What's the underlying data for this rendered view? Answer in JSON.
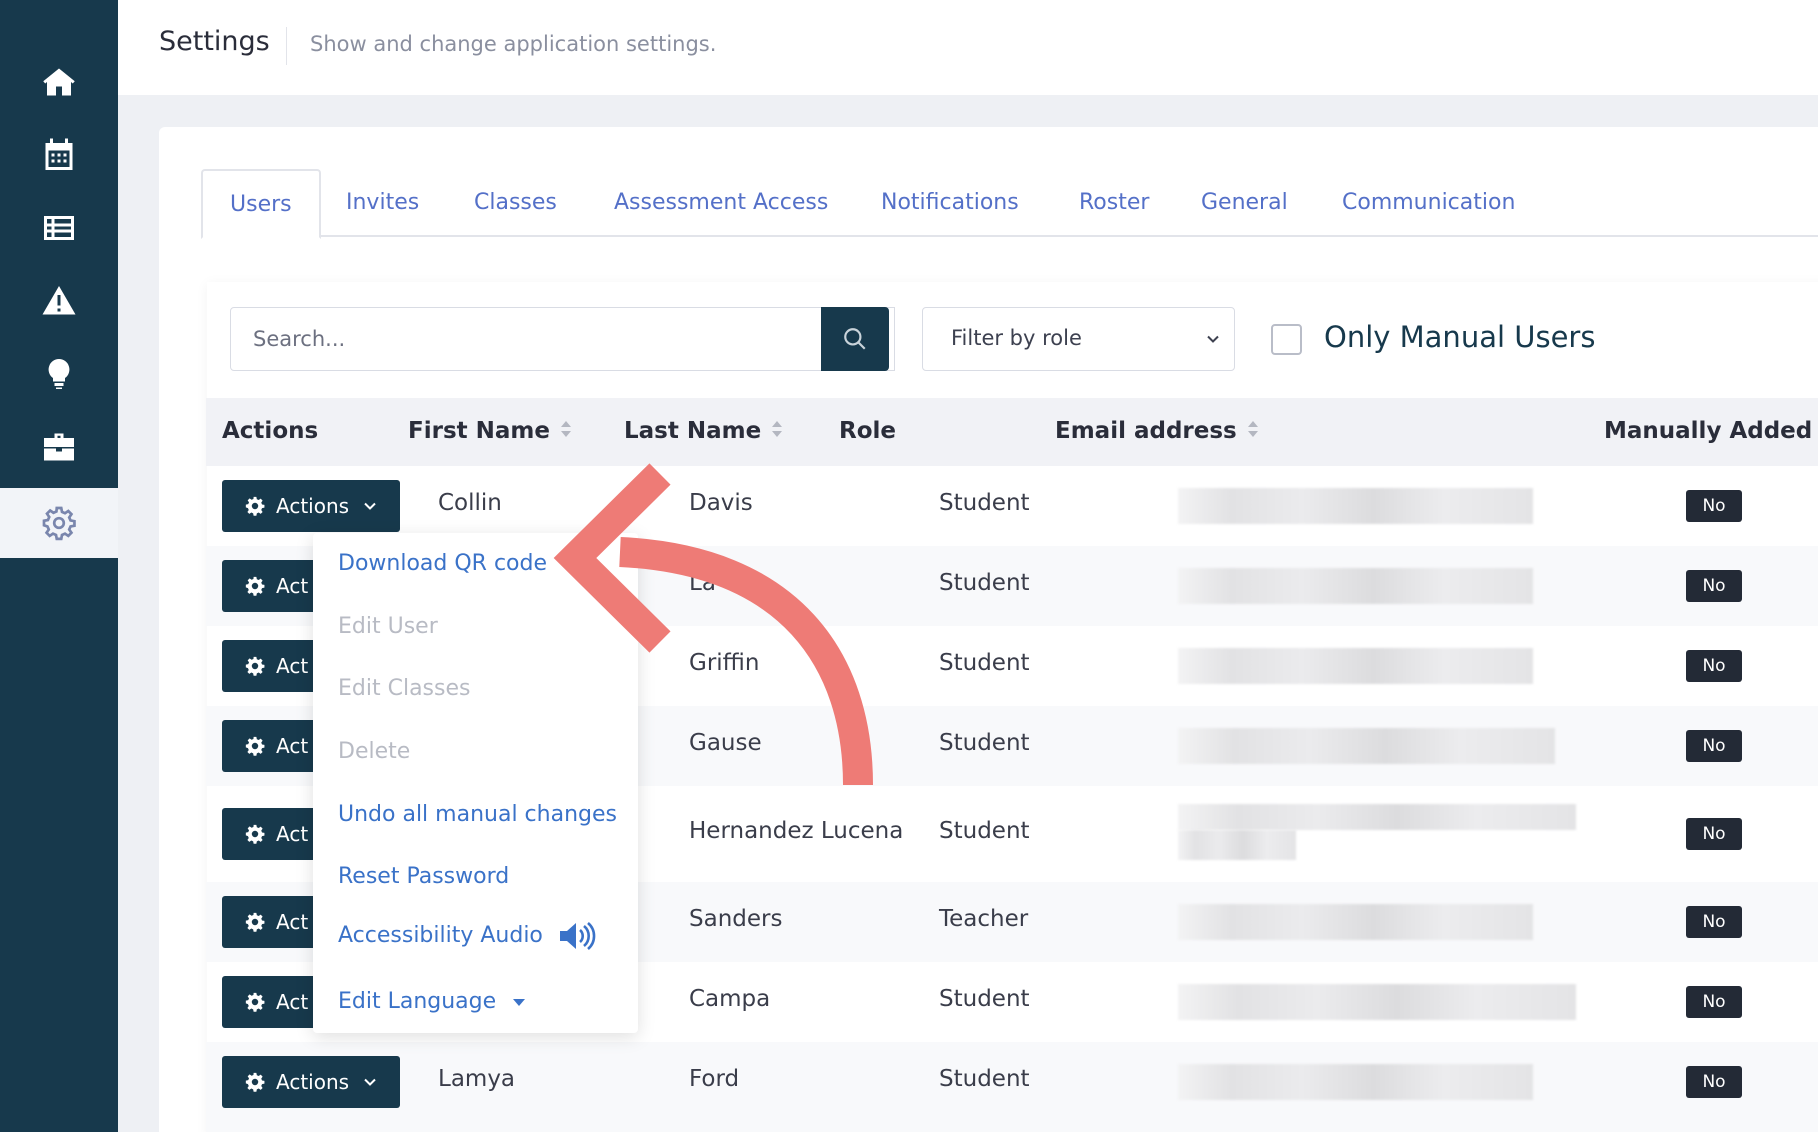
{
  "header": {
    "title": "Settings",
    "subtitle": "Show and change application settings."
  },
  "sidebar": {
    "items": [
      {
        "icon": "home-icon"
      },
      {
        "icon": "calendar-icon"
      },
      {
        "icon": "list-icon"
      },
      {
        "icon": "warning-icon"
      },
      {
        "icon": "lightbulb-icon"
      },
      {
        "icon": "toolbox-icon"
      },
      {
        "icon": "gear-icon",
        "active": true
      }
    ]
  },
  "tabs": [
    "Users",
    "Invites",
    "Classes",
    "Assessment Access",
    "Notifications",
    "Roster",
    "General",
    "Communication"
  ],
  "search": {
    "placeholder": "Search..."
  },
  "filter": {
    "label": "Filter by role"
  },
  "manual_checkbox": {
    "label": "Only Manual Users",
    "checked": false
  },
  "table": {
    "headers": {
      "actions": "Actions",
      "first_name": "First Name",
      "last_name": "Last Name",
      "role": "Role",
      "email": "Email address",
      "manually_added": "Manually Added"
    },
    "action_label": "Actions",
    "action_label_short": "Act",
    "rows": [
      {
        "first": "Collin",
        "last": "Davis",
        "role": "Student",
        "manual": "No"
      },
      {
        "first": "",
        "last": "La",
        "role": "Student",
        "manual": "No"
      },
      {
        "first": "",
        "last": "Griffin",
        "role": "Student",
        "manual": "No"
      },
      {
        "first": "",
        "last": "Gause",
        "role": "Student",
        "manual": "No"
      },
      {
        "first": "",
        "last": "Hernandez Lucena",
        "role": "Student",
        "manual": "No"
      },
      {
        "first": "",
        "last": "Sanders",
        "role": "Teacher",
        "manual": "No"
      },
      {
        "first": "",
        "last": "Campa",
        "role": "Student",
        "manual": "No"
      },
      {
        "first": "Lamya",
        "last": "Ford",
        "role": "Student",
        "manual": "No"
      }
    ]
  },
  "dropdown": {
    "items": [
      {
        "label": "Download QR code",
        "enabled": true
      },
      {
        "label": "Edit User",
        "enabled": false
      },
      {
        "label": "Edit Classes",
        "enabled": false
      },
      {
        "label": "Delete",
        "enabled": false
      },
      {
        "label": "Undo all manual changes",
        "enabled": true
      },
      {
        "label": "Reset Password",
        "enabled": true
      },
      {
        "label": "Accessibility Audio",
        "enabled": true,
        "icon": "speaker-icon"
      },
      {
        "label": "Edit Language",
        "enabled": true,
        "icon": "caret-down-icon"
      }
    ]
  },
  "colors": {
    "sidebar": "#17394c",
    "link": "#5470c8",
    "annotation_arrow": "#ee7b76",
    "badge": "#232a36"
  }
}
